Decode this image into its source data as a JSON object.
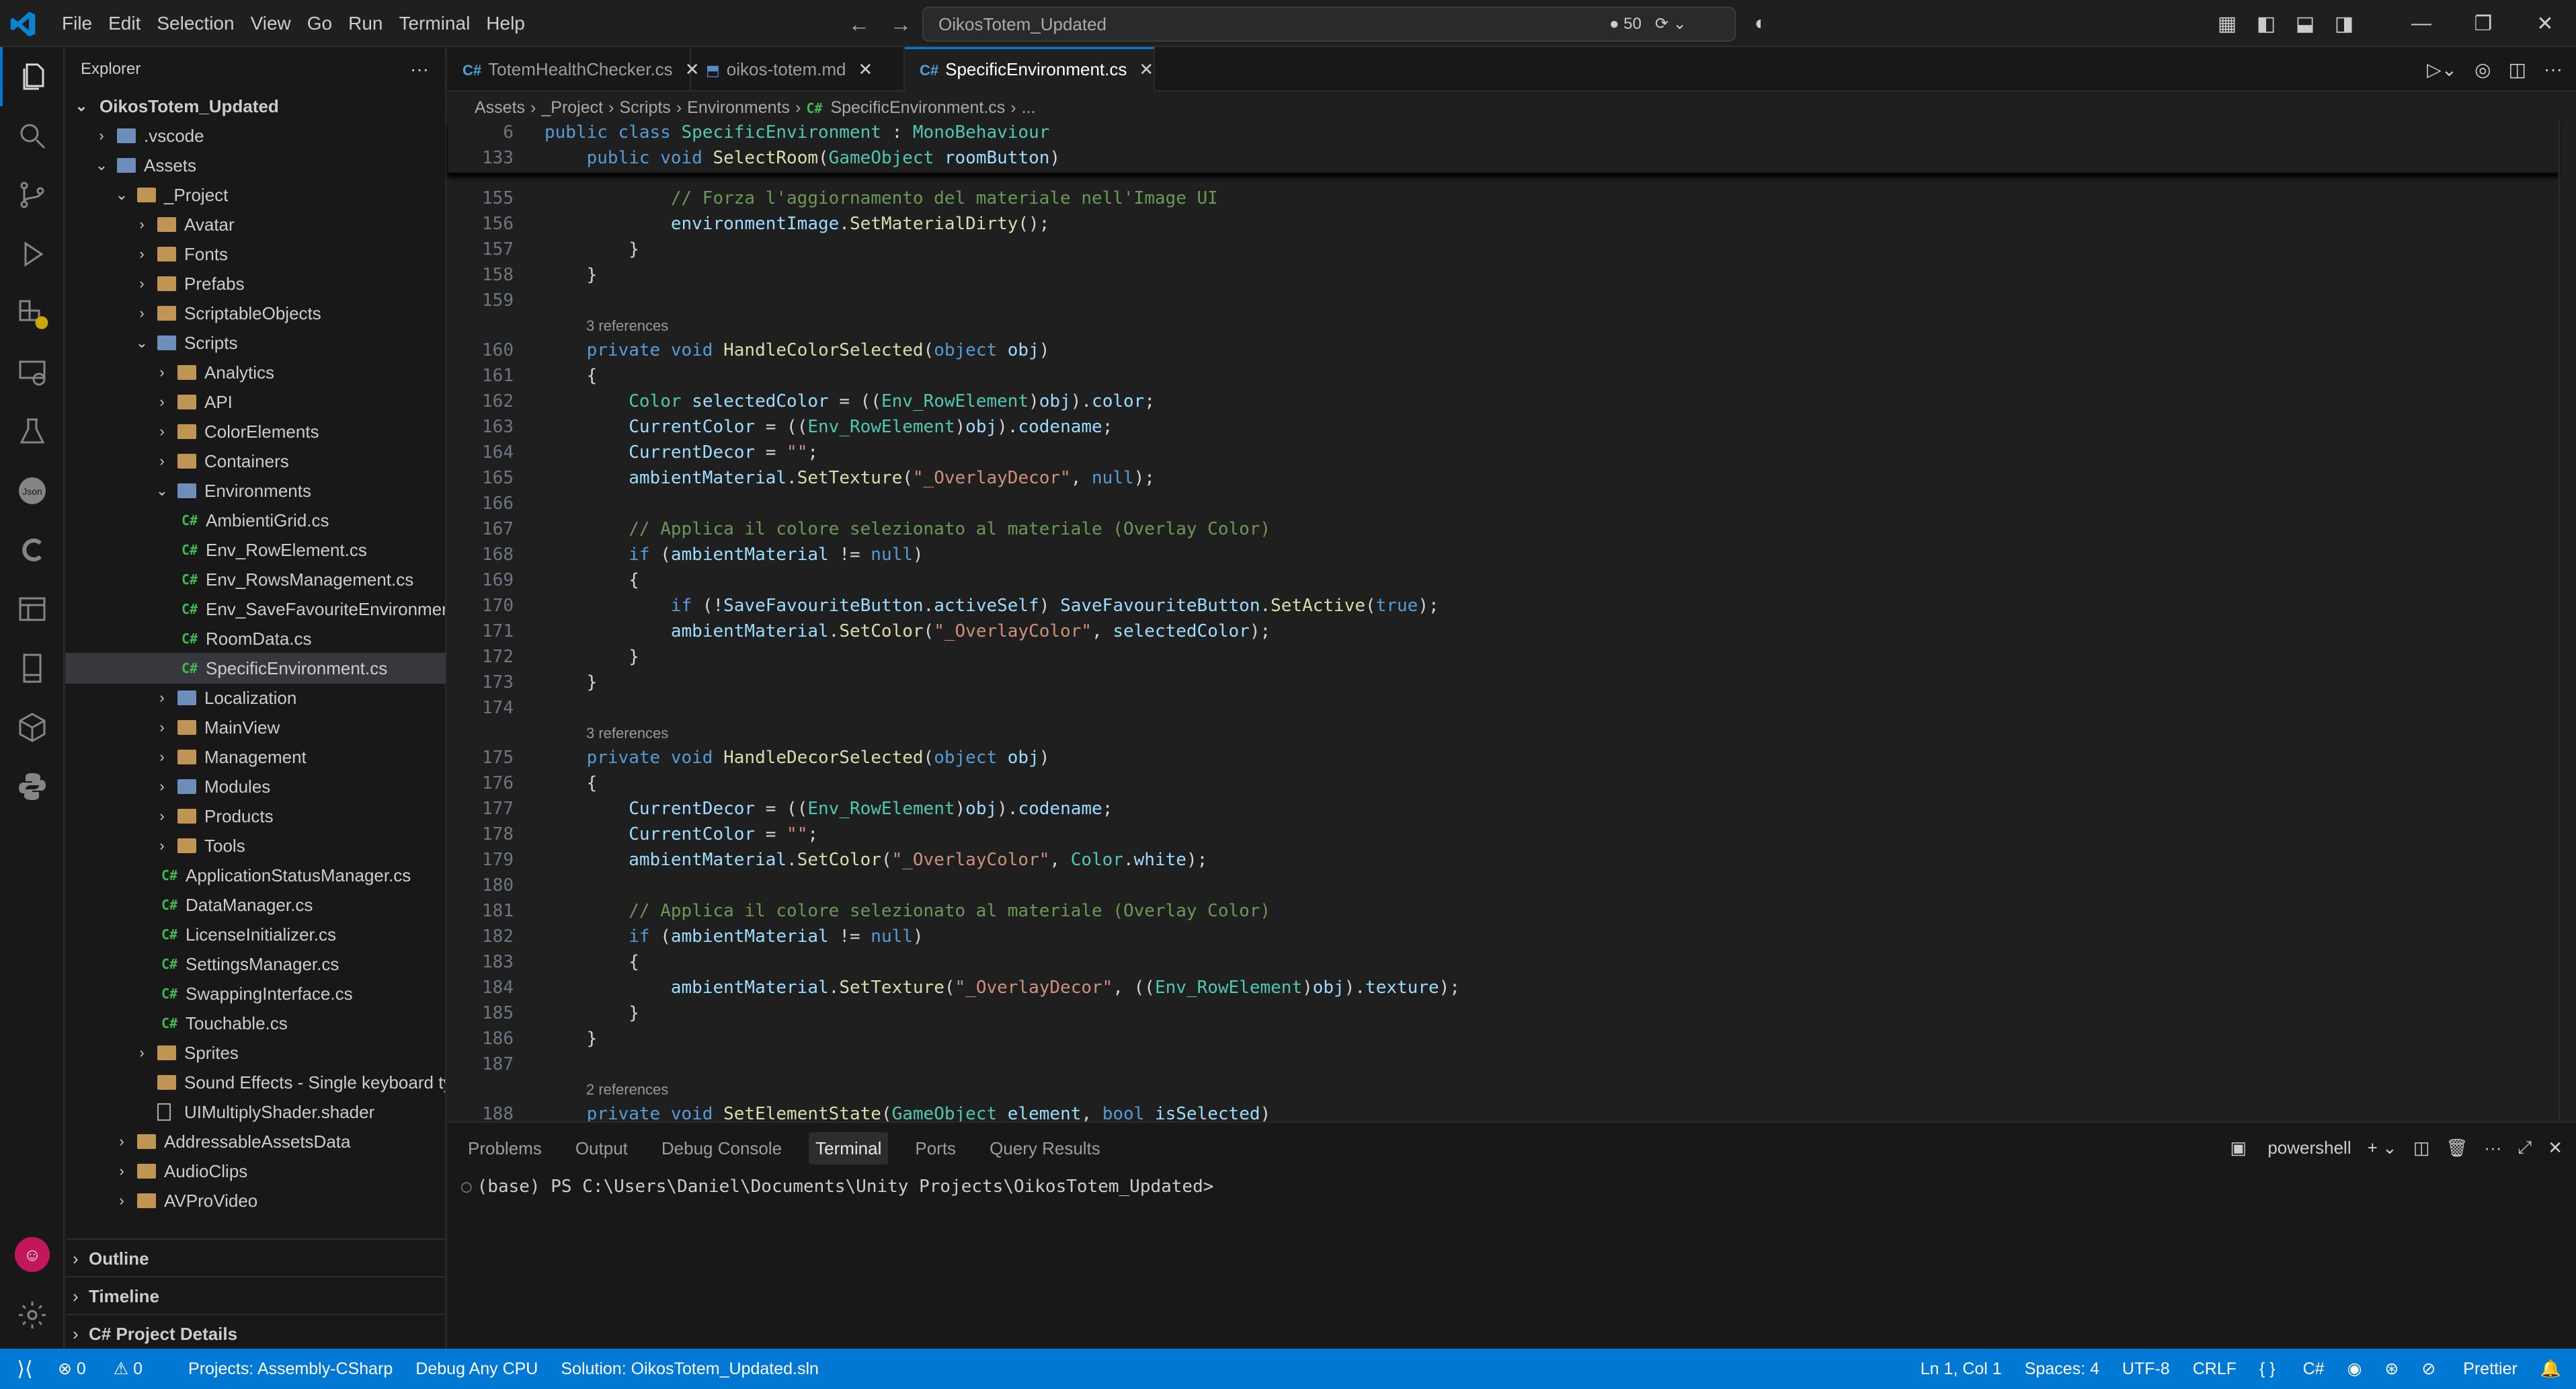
{
  "titlebar": {
    "menus": [
      "File",
      "Edit",
      "Selection",
      "View",
      "Go",
      "Run",
      "Terminal",
      "Help"
    ],
    "search": "OikosTotem_Updated",
    "changes_count": "50"
  },
  "sidebar": {
    "title": "Explorer",
    "root": "OikosTotem_Updated",
    "items": [
      {
        "label": ".vscode",
        "depth": 1,
        "kind": "special",
        "chev": "›"
      },
      {
        "label": "Assets",
        "depth": 1,
        "kind": "special",
        "chev": "⌄"
      },
      {
        "label": "_Project",
        "depth": 2,
        "kind": "folder",
        "chev": "⌄"
      },
      {
        "label": "Avatar",
        "depth": 3,
        "kind": "folder",
        "chev": "›"
      },
      {
        "label": "Fonts",
        "depth": 3,
        "kind": "folder",
        "chev": "›"
      },
      {
        "label": "Prefabs",
        "depth": 3,
        "kind": "folder",
        "chev": "›"
      },
      {
        "label": "ScriptableObjects",
        "depth": 3,
        "kind": "folder",
        "chev": "›"
      },
      {
        "label": "Scripts",
        "depth": 3,
        "kind": "special",
        "chev": "⌄"
      },
      {
        "label": "Analytics",
        "depth": 4,
        "kind": "folder",
        "chev": "›"
      },
      {
        "label": "API",
        "depth": 4,
        "kind": "folder",
        "chev": "›"
      },
      {
        "label": "ColorElements",
        "depth": 4,
        "kind": "folder",
        "chev": "›"
      },
      {
        "label": "Containers",
        "depth": 4,
        "kind": "folder",
        "chev": "›"
      },
      {
        "label": "Environments",
        "depth": 4,
        "kind": "special",
        "chev": "⌄"
      },
      {
        "label": "AmbientiGrid.cs",
        "depth": 5,
        "kind": "cs"
      },
      {
        "label": "Env_RowElement.cs",
        "depth": 5,
        "kind": "cs"
      },
      {
        "label": "Env_RowsManagement.cs",
        "depth": 5,
        "kind": "cs"
      },
      {
        "label": "Env_SaveFavouriteEnvironment....",
        "depth": 5,
        "kind": "cs"
      },
      {
        "label": "RoomData.cs",
        "depth": 5,
        "kind": "cs"
      },
      {
        "label": "SpecificEnvironment.cs",
        "depth": 5,
        "kind": "cs",
        "selected": true
      },
      {
        "label": "Localization",
        "depth": 4,
        "kind": "special",
        "chev": "›"
      },
      {
        "label": "MainView",
        "depth": 4,
        "kind": "folder",
        "chev": "›"
      },
      {
        "label": "Management",
        "depth": 4,
        "kind": "folder",
        "chev": "›"
      },
      {
        "label": "Modules",
        "depth": 4,
        "kind": "special",
        "chev": "›"
      },
      {
        "label": "Products",
        "depth": 4,
        "kind": "folder",
        "chev": "›"
      },
      {
        "label": "Tools",
        "depth": 4,
        "kind": "folder",
        "chev": "›"
      },
      {
        "label": "ApplicationStatusManager.cs",
        "depth": 4,
        "kind": "cs"
      },
      {
        "label": "DataManager.cs",
        "depth": 4,
        "kind": "cs"
      },
      {
        "label": "LicenseInitializer.cs",
        "depth": 4,
        "kind": "cs"
      },
      {
        "label": "SettingsManager.cs",
        "depth": 4,
        "kind": "cs"
      },
      {
        "label": "SwappingInterface.cs",
        "depth": 4,
        "kind": "cs"
      },
      {
        "label": "Touchable.cs",
        "depth": 4,
        "kind": "cs"
      },
      {
        "label": "Sprites",
        "depth": 3,
        "kind": "folder",
        "chev": "›"
      },
      {
        "label": "Sound Effects - Single keyboard ty...",
        "depth": 3,
        "kind": "folder"
      },
      {
        "label": "UIMultiplyShader.shader",
        "depth": 3,
        "kind": "file"
      },
      {
        "label": "AddressableAssetsData",
        "depth": 2,
        "kind": "folder",
        "chev": "›"
      },
      {
        "label": "AudioClips",
        "depth": 2,
        "kind": "folder",
        "chev": "›"
      },
      {
        "label": "AVProVideo",
        "depth": 2,
        "kind": "folder",
        "chev": "›"
      }
    ],
    "sections": [
      "Outline",
      "Timeline",
      "C# Project Details"
    ]
  },
  "tabs": [
    {
      "label": "TotemHealthChecker.cs",
      "icon": "C#"
    },
    {
      "label": "oikos-totem.md",
      "icon": "md"
    },
    {
      "label": "SpecificEnvironment.cs",
      "icon": "C#",
      "active": true
    }
  ],
  "breadcrumb": [
    "Assets",
    "_Project",
    "Scripts",
    "Environments",
    "SpecificEnvironment.cs",
    "..."
  ],
  "sticky": [
    {
      "ln": "6",
      "html": "<span class='kw'>public class</span> <span class='ty'>SpecificEnvironment</span> : <span class='ty'>MonoBehaviour</span>"
    },
    {
      "ln": "133",
      "html": "    <span class='kw'>public void</span> <span class='fn'>SelectRoom</span>(<span class='ty'>GameObject</span> <span class='pm'>roomButton</span>)"
    }
  ],
  "code": [
    {
      "ln": "155",
      "html": "            <span class='cm'>// Forza l'aggiornamento del materiale nell'Image UI</span>"
    },
    {
      "ln": "156",
      "html": "            <span class='fi'>environmentImage</span>.<span class='fn'>SetMaterialDirty</span>();"
    },
    {
      "ln": "157",
      "html": "        }"
    },
    {
      "ln": "158",
      "html": "    }"
    },
    {
      "ln": "159",
      "html": ""
    },
    {
      "lens": "3 references"
    },
    {
      "ln": "160",
      "html": "    <span class='kw'>private void</span> <span class='fn'>HandleColorSelected</span>(<span class='kw'>object</span> <span class='pm'>obj</span>)"
    },
    {
      "ln": "161",
      "html": "    {"
    },
    {
      "ln": "162",
      "html": "        <span class='ty'>Color</span> <span class='pm'>selectedColor</span> = ((<span class='ty'>Env_RowElement</span>)<span class='pm'>obj</span>).<span class='fi'>color</span>;"
    },
    {
      "ln": "163",
      "html": "        <span class='fi'>CurrentColor</span> = ((<span class='ty'>Env_RowElement</span>)<span class='pm'>obj</span>).<span class='fi'>codename</span>;"
    },
    {
      "ln": "164",
      "html": "        <span class='fi'>CurrentDecor</span> = <span class='st'>\"\"</span>;"
    },
    {
      "ln": "165",
      "html": "        <span class='fi'>ambientMaterial</span>.<span class='fn'>SetTexture</span>(<span class='st'>\"_OverlayDecor\"</span>, <span class='kw'>null</span>);"
    },
    {
      "ln": "166",
      "html": ""
    },
    {
      "ln": "167",
      "html": "        <span class='cm'>// Applica il colore selezionato al materiale (Overlay Color)</span>"
    },
    {
      "ln": "168",
      "html": "        <span class='kw'>if</span> (<span class='fi'>ambientMaterial</span> != <span class='kw'>null</span>)"
    },
    {
      "ln": "169",
      "html": "        {"
    },
    {
      "ln": "170",
      "html": "            <span class='kw'>if</span> (!<span class='fi'>SaveFavouriteButton</span>.<span class='fi'>activeSelf</span>) <span class='fi'>SaveFavouriteButton</span>.<span class='fn'>SetActive</span>(<span class='kw'>true</span>);"
    },
    {
      "ln": "171",
      "html": "            <span class='fi'>ambientMaterial</span>.<span class='fn'>SetColor</span>(<span class='st'>\"_OverlayColor\"</span>, <span class='pm'>selectedColor</span>);"
    },
    {
      "ln": "172",
      "html": "        }"
    },
    {
      "ln": "173",
      "html": "    }"
    },
    {
      "ln": "174",
      "html": ""
    },
    {
      "lens": "3 references"
    },
    {
      "ln": "175",
      "html": "    <span class='kw'>private void</span> <span class='fn'>HandleDecorSelected</span>(<span class='kw'>object</span> <span class='pm'>obj</span>)"
    },
    {
      "ln": "176",
      "html": "    {"
    },
    {
      "ln": "177",
      "html": "        <span class='fi'>CurrentDecor</span> = ((<span class='ty'>Env_RowElement</span>)<span class='pm'>obj</span>).<span class='fi'>codename</span>;"
    },
    {
      "ln": "178",
      "html": "        <span class='fi'>CurrentColor</span> = <span class='st'>\"\"</span>;"
    },
    {
      "ln": "179",
      "html": "        <span class='fi'>ambientMaterial</span>.<span class='fn'>SetColor</span>(<span class='st'>\"_OverlayColor\"</span>, <span class='ty'>Color</span>.<span class='fi'>white</span>);"
    },
    {
      "ln": "180",
      "html": ""
    },
    {
      "ln": "181",
      "html": "        <span class='cm'>// Applica il colore selezionato al materiale (Overlay Color)</span>"
    },
    {
      "ln": "182",
      "html": "        <span class='kw'>if</span> (<span class='fi'>ambientMaterial</span> != <span class='kw'>null</span>)"
    },
    {
      "ln": "183",
      "html": "        {"
    },
    {
      "ln": "184",
      "html": "            <span class='fi'>ambientMaterial</span>.<span class='fn'>SetTexture</span>(<span class='st'>\"_OverlayDecor\"</span>, ((<span class='ty'>Env_RowElement</span>)<span class='pm'>obj</span>).<span class='fi'>texture</span>);"
    },
    {
      "ln": "185",
      "html": "        }"
    },
    {
      "ln": "186",
      "html": "    }"
    },
    {
      "ln": "187",
      "html": ""
    },
    {
      "lens": "2 references"
    },
    {
      "ln": "188",
      "html": "    <span class='kw'>private void</span> <span class='fn'>SetElementState</span>(<span class='ty'>GameObject</span> <span class='pm'>element</span>, <span class='kw'>bool</span> <span class='pm'>isSelected</span>)"
    }
  ],
  "panel": {
    "tabs": [
      "Problems",
      "Output",
      "Debug Console",
      "Terminal",
      "Ports",
      "Query Results"
    ],
    "active_tab": "Terminal",
    "shell": "powershell",
    "terminal_line": "(base) PS C:\\Users\\Daniel\\Documents\\Unity Projects\\OikosTotem_Updated>"
  },
  "status": {
    "errors": "0",
    "warnings": "0",
    "projects": "Projects: Assembly-CSharp",
    "debug": "Debug Any CPU",
    "solution": "Solution: OikosTotem_Updated.sln",
    "position": "Ln 1, Col 1",
    "spaces": "Spaces: 4",
    "encoding": "UTF-8",
    "eol": "CRLF",
    "language": "C#",
    "prettier": "Prettier"
  },
  "colors": {
    "accent": "#0078d4",
    "statusbar": "#0078d4",
    "editor_bg": "#1f1f1f",
    "sidebar_bg": "#181818"
  }
}
